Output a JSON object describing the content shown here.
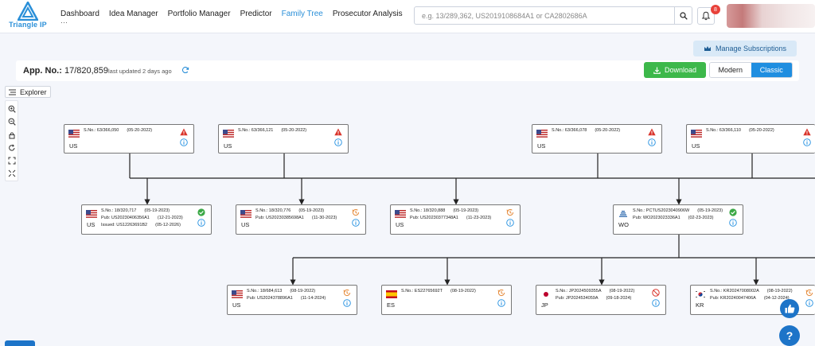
{
  "brand": {
    "name": "Triangle IP"
  },
  "nav": {
    "items": [
      {
        "label": "Dashboard",
        "active": false
      },
      {
        "label": "Idea Manager",
        "active": false
      },
      {
        "label": "Portfolio Manager",
        "active": false
      },
      {
        "label": "Predictor",
        "active": false
      },
      {
        "label": "Family Tree",
        "active": true
      },
      {
        "label": "Prosecutor Analysis",
        "active": false
      }
    ],
    "dashboard_dots": "···"
  },
  "search": {
    "placeholder": "e.g. 13/289,362, US2019108684A1 or CA2802686A",
    "value": ""
  },
  "notifications": {
    "count": "8"
  },
  "subscription": {
    "label": "Manage Subscriptions"
  },
  "app": {
    "label": "App. No.:",
    "number": "17/820,859",
    "last_updated": "last updated 2 days ago"
  },
  "actions": {
    "download": "Download",
    "view_modern": "Modern",
    "view_classic": "Classic",
    "active_view": "Classic"
  },
  "explorer": {
    "label": "Explorer"
  },
  "tools": [
    "zoom-in-icon",
    "zoom-out-icon",
    "lock-icon",
    "reset-icon",
    "fit-icon",
    "fullscreen-icon"
  ],
  "colors": {
    "accent": "#1f8ee0",
    "download": "#3db84a",
    "warning": "#d9342b",
    "ok": "#3aa845",
    "pending": "#e58a3a"
  },
  "tree": {
    "parents": [
      {
        "country": "US",
        "flag": "us",
        "sno": "S.No.: 63/366,050",
        "date": "(05-20-2022)",
        "status": "warning"
      },
      {
        "country": "US",
        "flag": "us",
        "sno": "S.No.: 63/366,121",
        "date": "(05-20-2022)",
        "status": "warning"
      },
      {
        "country": "US",
        "flag": "us",
        "sno": "S.No.: 63/366,078",
        "date": "(05-20-2022)",
        "status": "warning"
      },
      {
        "country": "US",
        "flag": "us",
        "sno": "S.No.: 63/366,110",
        "date": "(05-20-2022)",
        "status": "warning"
      }
    ],
    "children": [
      {
        "country": "US",
        "flag": "us",
        "sno": "S.No.: 18/320,717",
        "date": "(05-19-2023)",
        "pub": "Pub: US20230406356A1",
        "pub_date": "(12-21-2023)",
        "issued": "Issued: US12263691B2",
        "issued_date": "(05-12-2026)",
        "status": "ok"
      },
      {
        "country": "US",
        "flag": "us",
        "sno": "S.No.: 18/320,776",
        "date": "(05-19-2023)",
        "pub": "Pub: US20230385698A1",
        "pub_date": "(11-30-2023)",
        "status": "pending"
      },
      {
        "country": "US",
        "flag": "us",
        "sno": "S.No.: 18/320,888",
        "date": "(05-19-2023)",
        "pub": "Pub: US20230377348A1",
        "pub_date": "(11-23-2023)",
        "status": "pending"
      },
      {
        "country": "WO",
        "flag": "wo",
        "sno": "S.No.: PCTUS2023040906W",
        "date": "(05-19-2023)",
        "pub": "Pub: WO2023023336A1",
        "pub_date": "(02-23-2023)",
        "status": "ok"
      }
    ],
    "grandchildren": [
      {
        "country": "US",
        "flag": "us",
        "sno": "S.No.: 18/684,613",
        "date": "(08-19-2022)",
        "pub": "Pub: US20243788​96A1",
        "pub_date": "(11-14-2024)",
        "status": "pending"
      },
      {
        "country": "ES",
        "flag": "es",
        "sno": "S.No.: ES22765692T",
        "date": "(08-19-2022)",
        "status": "pending"
      },
      {
        "country": "JP",
        "flag": "jp",
        "sno": "S.No.: JP2024509355A",
        "date": "(08-19-2022)",
        "pub": "Pub: JP2024534059A",
        "pub_date": "(09-18-2024)",
        "status": "blocked"
      },
      {
        "country": "KR",
        "flag": "kr",
        "sno": "S.No.: KR20247008002A",
        "date": "(08-19-2022)",
        "pub": "Pub: KR20240047406A",
        "pub_date": "(04-12-2024)",
        "status": "pending"
      }
    ]
  }
}
